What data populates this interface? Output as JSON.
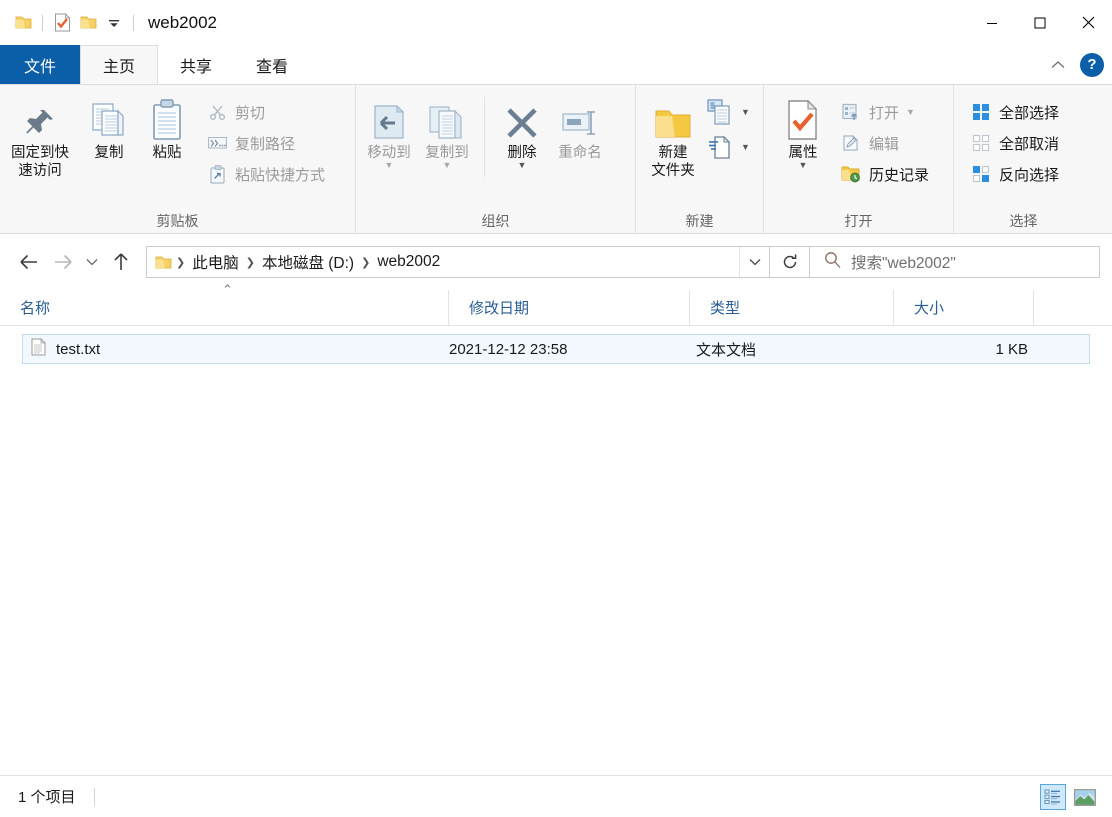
{
  "window": {
    "title": "web2002",
    "quick_access": [
      "folder-icon",
      "properties-check-icon",
      "new-folder-icon",
      "customize-caret-icon"
    ],
    "controls": {
      "minimize": "minimize-icon",
      "maximize": "maximize-icon",
      "close": "close-icon"
    }
  },
  "tabs": {
    "file": "文件",
    "items": [
      {
        "label": "主页",
        "active": true
      },
      {
        "label": "共享",
        "active": false
      },
      {
        "label": "查看",
        "active": false
      }
    ],
    "collapse_ribbon": "chevron-up-icon",
    "help": "?"
  },
  "ribbon": {
    "groups": [
      {
        "name": "clipboard",
        "label": "剪贴板",
        "big_buttons": [
          {
            "label": "固定到快\n速访问",
            "label_l1": "固定到快",
            "label_l2": "速访问",
            "icon": "pin-icon",
            "disabled": false
          },
          {
            "label": "复制",
            "icon": "copy-icon",
            "disabled": false
          },
          {
            "label": "粘贴",
            "icon": "paste-icon",
            "disabled": false
          }
        ],
        "small_buttons": [
          {
            "label": "剪切",
            "icon": "scissors-icon",
            "disabled": true
          },
          {
            "label": "复制路径",
            "icon": "copy-path-icon",
            "disabled": true
          },
          {
            "label": "粘贴快捷方式",
            "icon": "paste-shortcut-icon",
            "disabled": true
          }
        ]
      },
      {
        "name": "organize",
        "label": "组织",
        "big_buttons": [
          {
            "label": "移动到",
            "icon": "move-to-icon",
            "disabled": true,
            "caret": true
          },
          {
            "label": "复制到",
            "icon": "copy-to-icon",
            "disabled": true,
            "caret": true
          },
          {
            "label": "删除",
            "icon": "delete-x-icon",
            "disabled": false,
            "caret": true
          },
          {
            "label": "重命名",
            "icon": "rename-icon",
            "disabled": true
          }
        ]
      },
      {
        "name": "new",
        "label": "新建",
        "big_buttons": [
          {
            "label": "新建\n文件夹",
            "label_l1": "新建",
            "label_l2": "文件夹",
            "icon": "new-folder-icon",
            "disabled": false
          }
        ],
        "stack_buttons": [
          {
            "icon": "new-item-icon",
            "caret": true
          },
          {
            "icon": "easy-access-icon",
            "caret": true
          }
        ]
      },
      {
        "name": "open",
        "label": "打开",
        "big_buttons": [
          {
            "label": "属性",
            "icon": "properties-icon",
            "disabled": false,
            "caret": true
          }
        ],
        "small_buttons": [
          {
            "label": "打开",
            "icon": "open-icon",
            "disabled": true,
            "caret": true
          },
          {
            "label": "编辑",
            "icon": "edit-icon",
            "disabled": true
          },
          {
            "label": "历史记录",
            "icon": "history-icon",
            "disabled": false
          }
        ]
      },
      {
        "name": "select",
        "label": "选择",
        "small_buttons": [
          {
            "label": "全部选择",
            "icon": "select-all-icon",
            "disabled": false
          },
          {
            "label": "全部取消",
            "icon": "select-none-icon",
            "disabled": false
          },
          {
            "label": "反向选择",
            "icon": "invert-selection-icon",
            "disabled": false
          }
        ]
      }
    ]
  },
  "navigation": {
    "back": "back-arrow-icon",
    "forward": "forward-arrow-icon",
    "recent": "recent-caret-icon",
    "up": "up-arrow-icon",
    "address_icon": "folder-icon",
    "breadcrumbs": [
      "此电脑",
      "本地磁盘 (D:)",
      "web2002"
    ],
    "address_caret": "chevron-down-icon",
    "refresh": "refresh-icon",
    "search_placeholder": "搜索\"web2002\"",
    "search_icon": "search-icon"
  },
  "columns": [
    {
      "label": "名称",
      "sorted": true,
      "sort_dir": "asc"
    },
    {
      "label": "修改日期",
      "sorted": false
    },
    {
      "label": "类型",
      "sorted": false
    },
    {
      "label": "大小",
      "sorted": false
    }
  ],
  "files": [
    {
      "icon": "text-file-icon",
      "name": "test.txt",
      "modified": "2021-12-12 23:58",
      "type": "文本文档",
      "size": "1 KB",
      "selected": true
    }
  ],
  "status": {
    "item_count": "1 个项目",
    "view_details": "details-view-icon",
    "view_large": "large-icons-view-icon"
  },
  "colors": {
    "accent": "#0b5ea8",
    "ribbon_bg": "#f7f7f7",
    "selection": "#f2f8fd",
    "selection_border": "#bfdcf3",
    "column_header_text": "#2a5d96",
    "folder_yellow": "#fbd872",
    "disabled_text": "#9b9b9b"
  }
}
